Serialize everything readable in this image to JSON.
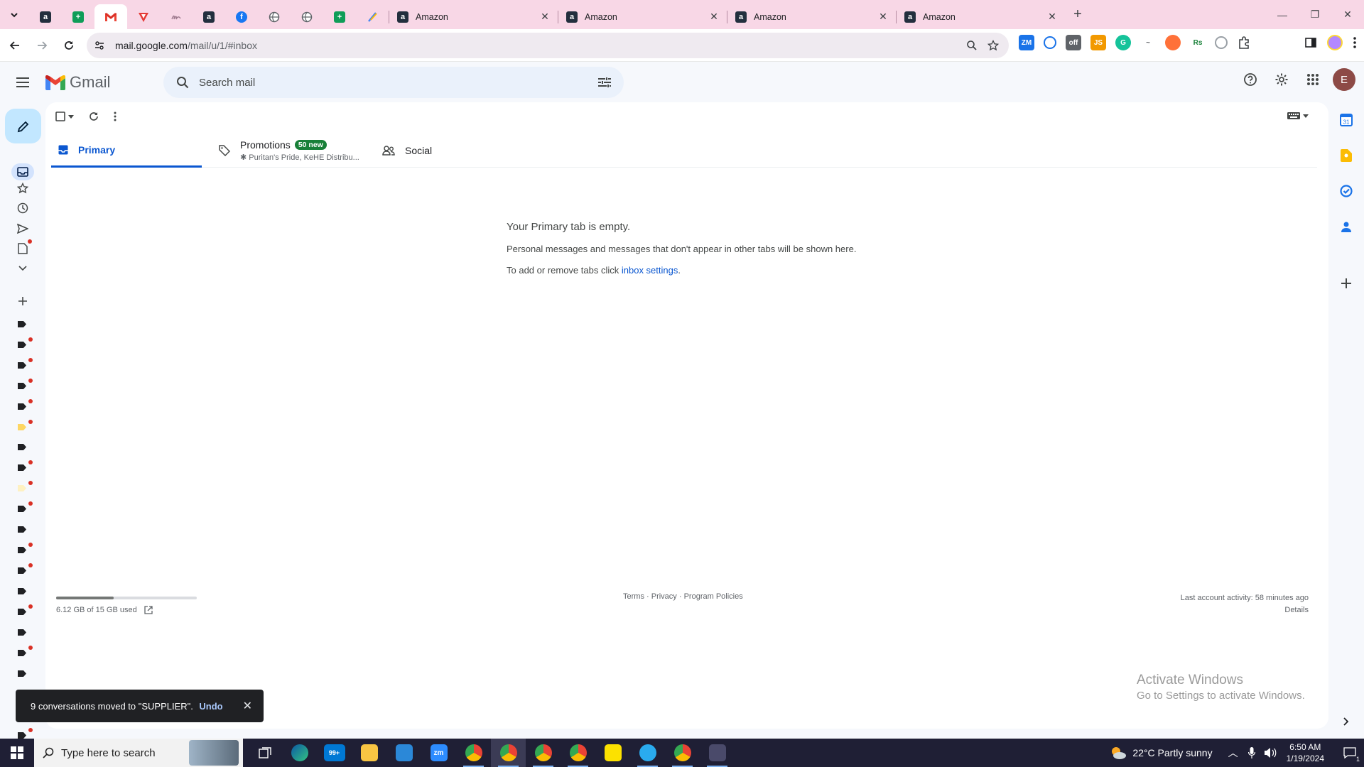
{
  "browser": {
    "pinned_tabs": [
      {
        "icon": "amazon-icon",
        "color": "#232f3e"
      },
      {
        "icon": "sheets-plus-icon",
        "color": "#0f9d58"
      },
      {
        "icon": "gmail-icon",
        "color": "#ea4335",
        "active": true
      },
      {
        "icon": "red-triangle-icon",
        "color": "#e53935"
      },
      {
        "icon": "signature-icon",
        "color": "#c0a0b0"
      },
      {
        "icon": "amazon-icon",
        "color": "#232f3e"
      },
      {
        "icon": "facebook-icon",
        "color": "#1877f2"
      },
      {
        "icon": "globe-icon",
        "color": "#5f6368"
      },
      {
        "icon": "globe-icon",
        "color": "#5f6368"
      },
      {
        "icon": "sheets-plus-icon",
        "color": "#0f9d58"
      },
      {
        "icon": "feather-icon",
        "color": "#4285f4"
      }
    ],
    "tabs": [
      {
        "title": "Amazon"
      },
      {
        "title": "Amazon"
      },
      {
        "title": "Amazon"
      },
      {
        "title": "Amazon"
      }
    ],
    "url_host": "mail.google.com",
    "url_path": "/mail/u/1/#inbox"
  },
  "gmail": {
    "logo_text": "Gmail",
    "search_placeholder": "Search mail",
    "avatar_letter": "E",
    "tabs": {
      "primary": "Primary",
      "promotions": "Promotions",
      "promotions_badge": "50 new",
      "promotions_sub": "✱ Puritan's Pride, KeHE Distribu...",
      "social": "Social"
    },
    "empty": {
      "heading": "Your Primary tab is empty.",
      "line1": "Personal messages and messages that don't appear in other tabs will be shown here.",
      "line2_prefix": "To add or remove tabs click ",
      "line2_link": "inbox settings",
      "line2_suffix": "."
    },
    "storage": {
      "text": "6.12 GB of 15 GB used",
      "fraction": 0.408
    },
    "footer": {
      "terms": "Terms",
      "privacy": "Privacy",
      "policies": "Program Policies",
      "sep": " · "
    },
    "last_activity": "Last account activity: 58 minutes ago",
    "details": "Details",
    "snackbar": {
      "message": "9 conversations moved to \"SUPPLIER\".",
      "undo": "Undo"
    }
  },
  "watermark": {
    "line1": "Activate Windows",
    "line2": "Go to Settings to activate Windows."
  },
  "taskbar": {
    "search_placeholder": "Type here to search",
    "weather": "22°C  Partly sunny",
    "time": "6:50 AM",
    "date": "1/19/2024",
    "mail_badge": "99+",
    "notif_count": "1"
  }
}
